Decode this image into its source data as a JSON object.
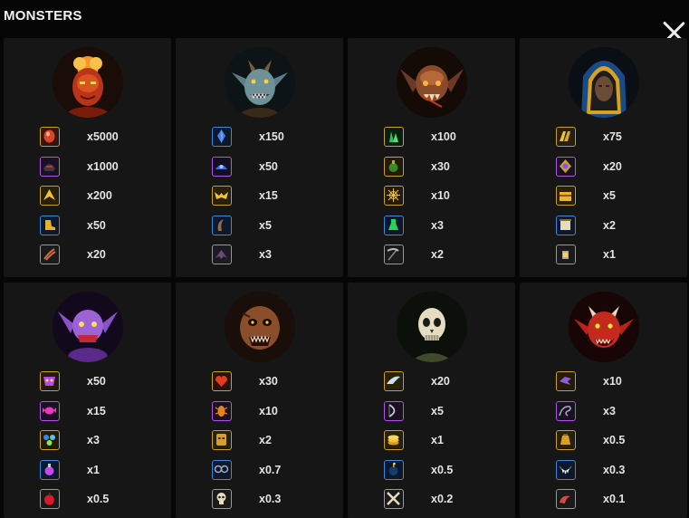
{
  "header": {
    "title": "MONSTERS"
  },
  "monsters": [
    {
      "name": "fire-demon",
      "payouts": [
        {
          "mult": "x5000",
          "icon": "red-gem-icon",
          "tier": "gold"
        },
        {
          "mult": "x1000",
          "icon": "dark-helmet-icon",
          "tier": "purple"
        },
        {
          "mult": "x200",
          "icon": "gold-wing-icon",
          "tier": "gold"
        },
        {
          "mult": "x50",
          "icon": "gold-boot-icon",
          "tier": "blue"
        },
        {
          "mult": "x20",
          "icon": "claw-icon",
          "tier": "gray"
        }
      ]
    },
    {
      "name": "goblin",
      "payouts": [
        {
          "mult": "x150",
          "icon": "blue-crystal-icon",
          "tier": "blue"
        },
        {
          "mult": "x50",
          "icon": "blue-helmet-icon",
          "tier": "purple"
        },
        {
          "mult": "x15",
          "icon": "gold-bat-icon",
          "tier": "gold"
        },
        {
          "mult": "x5",
          "icon": "horn-icon",
          "tier": "blue"
        },
        {
          "mult": "x3",
          "icon": "bat-wing-icon",
          "tier": "gray"
        }
      ]
    },
    {
      "name": "bat-demon",
      "payouts": [
        {
          "mult": "x100",
          "icon": "green-crystal-icon",
          "tier": "gold"
        },
        {
          "mult": "x30",
          "icon": "potion-icon",
          "tier": "gold"
        },
        {
          "mult": "x10",
          "icon": "spider-web-icon",
          "tier": "gold"
        },
        {
          "mult": "x3",
          "icon": "green-flask-icon",
          "tier": "blue"
        },
        {
          "mult": "x2",
          "icon": "scythe-icon",
          "tier": "gray"
        }
      ]
    },
    {
      "name": "hooded-rogue",
      "payouts": [
        {
          "mult": "x75",
          "icon": "gold-bars-icon",
          "tier": "gold"
        },
        {
          "mult": "x20",
          "icon": "amulet-icon",
          "tier": "purple"
        },
        {
          "mult": "x5",
          "icon": "treasure-chest-icon",
          "tier": "gold"
        },
        {
          "mult": "x2",
          "icon": "scroll-icon",
          "tier": "blue"
        },
        {
          "mult": "x1",
          "icon": "lantern-icon",
          "tier": "gray"
        }
      ]
    },
    {
      "name": "purple-imp",
      "payouts": [
        {
          "mult": "x50",
          "icon": "purple-mask-icon",
          "tier": "gold"
        },
        {
          "mult": "x15",
          "icon": "purple-candy-icon",
          "tier": "purple"
        },
        {
          "mult": "x3",
          "icon": "orbs-icon",
          "tier": "gold"
        },
        {
          "mult": "x1",
          "icon": "purple-potion-icon",
          "tier": "blue"
        },
        {
          "mult": "x0.5",
          "icon": "red-apple-icon",
          "tier": "gray"
        }
      ]
    },
    {
      "name": "zombie",
      "payouts": [
        {
          "mult": "x30",
          "icon": "heart-icon",
          "tier": "gold"
        },
        {
          "mult": "x10",
          "icon": "beetle-icon",
          "tier": "purple"
        },
        {
          "mult": "x2",
          "icon": "gold-mask-icon",
          "tier": "gold"
        },
        {
          "mult": "x0.7",
          "icon": "shackles-icon",
          "tier": "blue"
        },
        {
          "mult": "x0.3",
          "icon": "skull-icon",
          "tier": "gray"
        }
      ]
    },
    {
      "name": "skeleton",
      "payouts": [
        {
          "mult": "x20",
          "icon": "silver-wing-icon",
          "tier": "gold"
        },
        {
          "mult": "x5",
          "icon": "bow-icon",
          "tier": "purple"
        },
        {
          "mult": "x1",
          "icon": "gold-coins-icon",
          "tier": "gold"
        },
        {
          "mult": "x0.5",
          "icon": "bomb-icon",
          "tier": "blue"
        },
        {
          "mult": "x0.2",
          "icon": "crossbones-icon",
          "tier": "gray"
        }
      ]
    },
    {
      "name": "red-devil",
      "payouts": [
        {
          "mult": "x10",
          "icon": "purple-bird-icon",
          "tier": "gold"
        },
        {
          "mult": "x3",
          "icon": "whip-icon",
          "tier": "purple"
        },
        {
          "mult": "x0.5",
          "icon": "gold-sack-icon",
          "tier": "gold"
        },
        {
          "mult": "x0.3",
          "icon": "tooth-necklace-icon",
          "tier": "blue"
        },
        {
          "mult": "x0.1",
          "icon": "red-horn-icon",
          "tier": "gray"
        }
      ]
    }
  ]
}
